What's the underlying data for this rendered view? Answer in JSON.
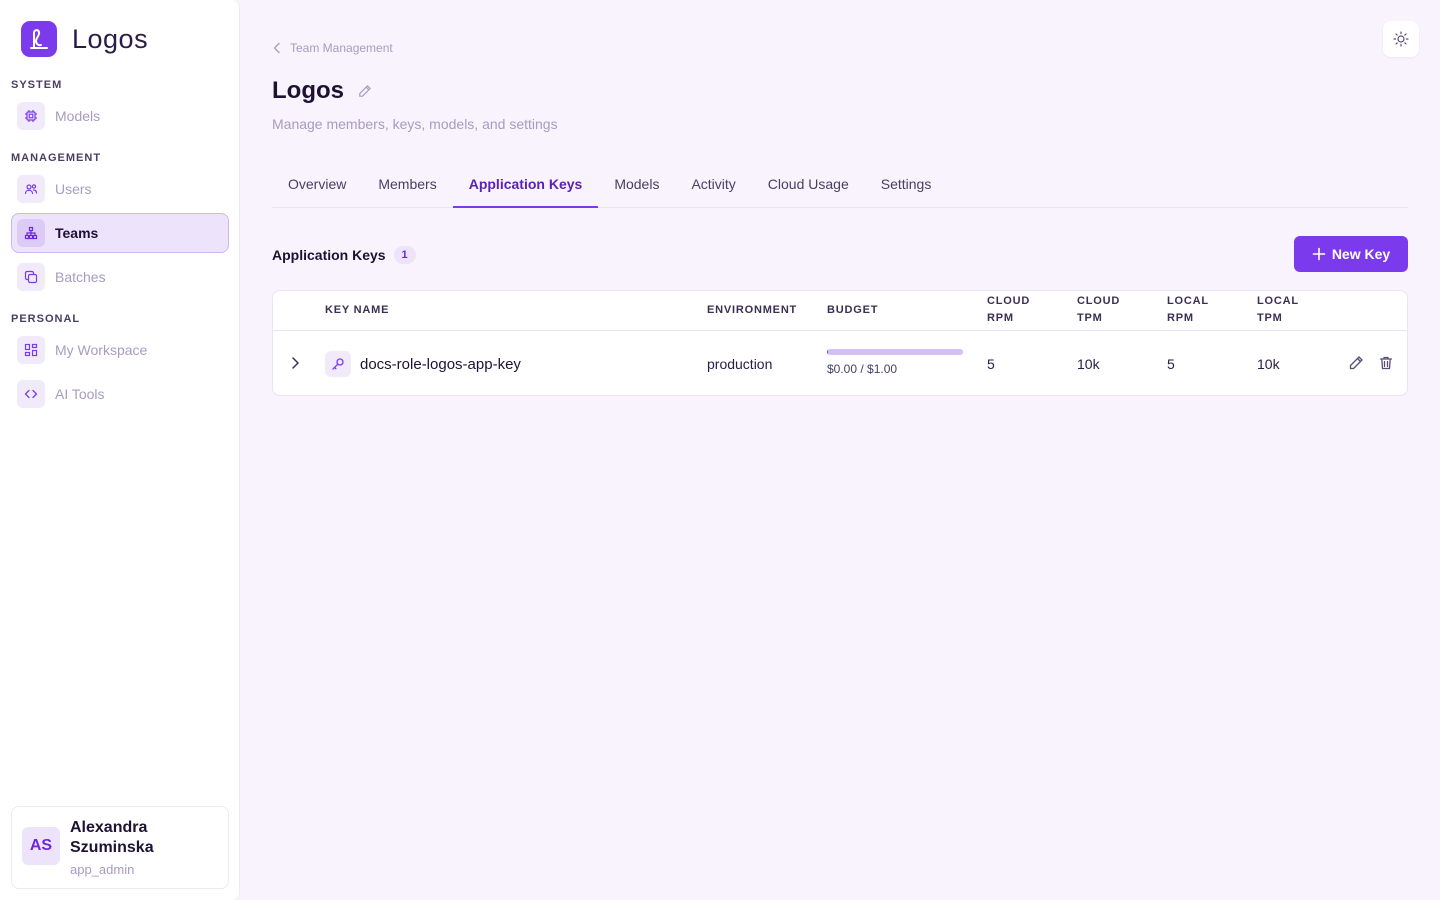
{
  "app": {
    "name": "Logos"
  },
  "sidebar": {
    "sections": {
      "system": "SYSTEM",
      "management": "MANAGEMENT",
      "personal": "PERSONAL"
    },
    "items": {
      "models": "Models",
      "users": "Users",
      "teams": "Teams",
      "batches": "Batches",
      "my_workspace": "My Workspace",
      "ai_tools": "AI Tools"
    },
    "active_item": "Teams"
  },
  "user": {
    "initials": "AS",
    "name": "Alexandra Szuminska",
    "role": "app_admin"
  },
  "header": {
    "breadcrumb": "Team Management",
    "title": "Logos",
    "subtitle": "Manage members, keys, models, and settings"
  },
  "tabs": {
    "overview": "Overview",
    "members": "Members",
    "application_keys": "Application Keys",
    "models": "Models",
    "activity": "Activity",
    "cloud_usage": "Cloud Usage",
    "settings": "Settings",
    "active": "Application Keys"
  },
  "keys_section": {
    "title": "Application Keys",
    "count": "1",
    "new_button": "New Key"
  },
  "table": {
    "headers": {
      "key_name": "KEY NAME",
      "environment": "ENVIRONMENT",
      "budget": "BUDGET",
      "cloud_rpm_1": "CLOUD",
      "cloud_rpm_2": "RPM",
      "cloud_tpm_1": "CLOUD",
      "cloud_tpm_2": "TPM",
      "local_rpm_1": "LOCAL",
      "local_rpm_2": "RPM",
      "local_tpm_1": "LOCAL",
      "local_tpm_2": "TPM"
    },
    "rows": [
      {
        "key_name": "docs-role-logos-app-key",
        "environment": "production",
        "budget_text": "$0.00 / $1.00",
        "budget_used_fraction": 0.01,
        "cloud_rpm": "5",
        "cloud_tpm": "10k",
        "local_rpm": "5",
        "local_tpm": "10k"
      }
    ]
  },
  "colors": {
    "accent": "#7c3aed",
    "accent_light": "#ede3fb",
    "background": "#f8f3fc"
  }
}
